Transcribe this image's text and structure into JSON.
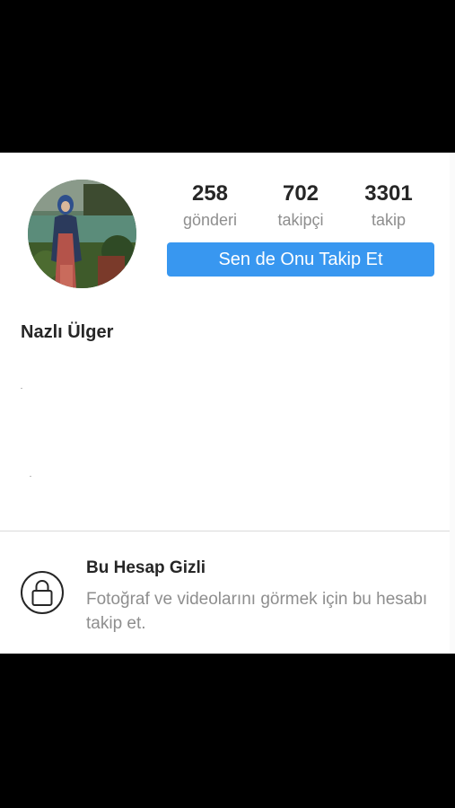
{
  "profile": {
    "name": "Nazlı Ülger",
    "stats": [
      {
        "value": "258",
        "label": "gönderi"
      },
      {
        "value": "702",
        "label": "takipçi"
      },
      {
        "value": "3301",
        "label": "takip"
      }
    ],
    "follow_label": "Sen de Onu Takip Et"
  },
  "private_notice": {
    "title": "Bu Hesap Gizli",
    "description": "Fotoğraf ve videolarını görmek için bu hesabı takip et."
  },
  "icons": {
    "avatar": "profile-photo",
    "lock": "lock-icon"
  },
  "colors": {
    "accent": "#3897f0",
    "text": "#262626",
    "muted": "#8e8e8e"
  }
}
